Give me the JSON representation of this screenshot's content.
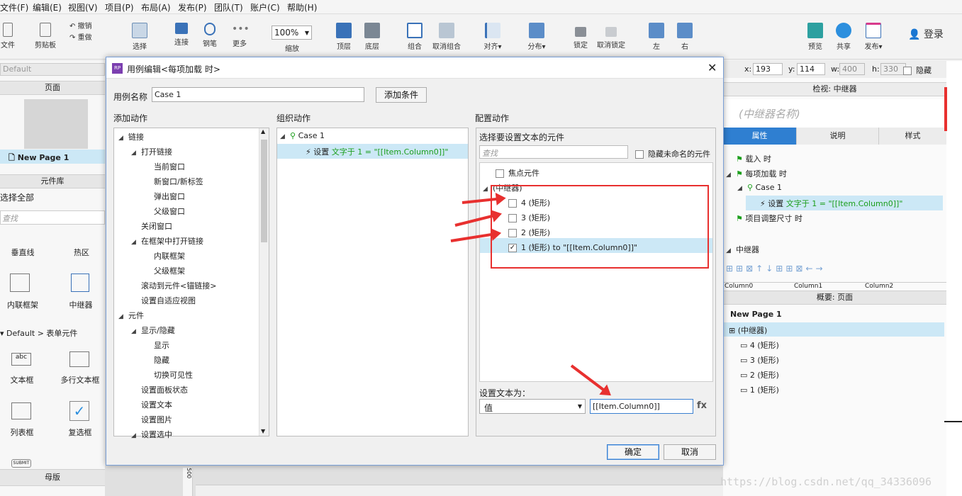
{
  "menu": [
    "文件(F)",
    "编辑(E)",
    "视图(V)",
    "项目(P)",
    "布局(A)",
    "发布(P)",
    "团队(T)",
    "账户(C)",
    "帮助(H)"
  ],
  "toolbar": {
    "file": "文件",
    "clipboard": "剪贴板",
    "undo": "撤销",
    "redo": "重做",
    "select": "选择",
    "connect": "连接",
    "pen": "钢笔",
    "more": "更多",
    "zoom_value": "100%",
    "zoom_label": "缩放",
    "top": "顶层",
    "bottom": "底层",
    "group": "组合",
    "ungroup": "取消组合",
    "align": "对齐",
    "distribute": "分布",
    "lock": "锁定",
    "unlock": "取消锁定",
    "left": "左",
    "right": "右",
    "preview": "预览",
    "share": "共享",
    "publish": "发布",
    "login": "登录"
  },
  "left_panel": {
    "style_select": "Default",
    "pages_header": "页面",
    "page_item": "New Page 1",
    "widgets_header": "元件库",
    "select_all": "选择全部",
    "search_placeholder": "查找",
    "widgets": [
      {
        "label": "垂直线"
      },
      {
        "label": "热区"
      },
      {
        "label": "内联框架"
      },
      {
        "label": "中继器"
      }
    ],
    "section": "Default > 表单元件",
    "form_widgets": [
      {
        "label": "文本框"
      },
      {
        "label": "多行文本框"
      },
      {
        "label": "列表框"
      },
      {
        "label": "复选框"
      }
    ],
    "submit": "SUBMIT",
    "masters_header": "母版"
  },
  "prop_bar": {
    "x_label": "x:",
    "x": "193",
    "y_label": "y:",
    "y": "114",
    "w_label": "w:",
    "w": "400",
    "h_label": "h:",
    "h": "330",
    "hide": "隐藏"
  },
  "right_panel": {
    "inspect_header": "检视: 中继器",
    "name_placeholder": "(中继器名称)",
    "tabs": [
      "属性",
      "说明",
      "样式"
    ],
    "events": [
      "载入 时",
      "每项加载 时",
      "Case 1",
      "设置",
      "文字于 1 = \"[[Item.Column0]]\"",
      "项目调整尺寸 时"
    ],
    "repeater_section": "中继器",
    "columns": [
      "Column0",
      "Column1",
      "Column2"
    ],
    "outline_header": "概要: 页面",
    "outline": [
      "New Page 1",
      "(中继器)",
      "4 (矩形)",
      "3 (矩形)",
      "2 (矩形)",
      "1 (矩形)"
    ]
  },
  "dialog": {
    "icon": "RP",
    "title": "用例编辑<每项加载 时>",
    "case_name_label": "用例名称",
    "case_name": "Case 1",
    "add_condition": "添加条件",
    "add_action_header": "添加动作",
    "organize_header": "组织动作",
    "configure_header": "配置动作",
    "actions": [
      {
        "text": "链接",
        "level": 0,
        "tri": "◢"
      },
      {
        "text": "打开链接",
        "level": 1,
        "tri": "◢"
      },
      {
        "text": "当前窗口",
        "level": 2
      },
      {
        "text": "新窗口/新标签",
        "level": 2
      },
      {
        "text": "弹出窗口",
        "level": 2
      },
      {
        "text": "父级窗口",
        "level": 2
      },
      {
        "text": "关闭窗口",
        "level": 1
      },
      {
        "text": "在框架中打开链接",
        "level": 1,
        "tri": "◢"
      },
      {
        "text": "内联框架",
        "level": 2
      },
      {
        "text": "父级框架",
        "level": 2
      },
      {
        "text": "滚动到元件<锚链接>",
        "level": 1
      },
      {
        "text": "设置自适应视图",
        "level": 1
      },
      {
        "text": "元件",
        "level": 0,
        "tri": "◢"
      },
      {
        "text": "显示/隐藏",
        "level": 1,
        "tri": "◢"
      },
      {
        "text": "显示",
        "level": 2
      },
      {
        "text": "隐藏",
        "level": 2
      },
      {
        "text": "切换可见性",
        "level": 2
      },
      {
        "text": "设置面板状态",
        "level": 1
      },
      {
        "text": "设置文本",
        "level": 1
      },
      {
        "text": "设置图片",
        "level": 1
      },
      {
        "text": "设置选中",
        "level": 1,
        "tri": "◢"
      }
    ],
    "organize": {
      "case": "Case 1",
      "action_prefix": "设置",
      "action_detail": "文字于 1 = \"[[Item.Column0]]\""
    },
    "configure": {
      "select_label": "选择要设置文本的元件",
      "search_placeholder": "查找",
      "hide_unnamed": "隐藏未命名的元件",
      "focus_widget": "焦点元件",
      "repeater": "(中继器)",
      "items": [
        {
          "label": "4 (矩形)",
          "checked": false
        },
        {
          "label": "3 (矩形)",
          "checked": false
        },
        {
          "label": "2 (矩形)",
          "checked": false
        },
        {
          "label": "1 (矩形) to \"[[Item.Column0]]\"",
          "checked": true
        }
      ],
      "set_text_label": "设置文本为：",
      "type_value": "值",
      "value": "[[Item.Column0]]",
      "fx": "fx"
    },
    "ok": "确定",
    "cancel": "取消"
  },
  "canvas": {
    "ruler_value": "500"
  },
  "watermark": "https://blog.csdn.net/qq_34336096",
  "colors": {
    "selected": "#cce8f6",
    "accent_blue": "#2f7fd1",
    "annotation_red": "#e8302f",
    "action_green": "#1b9e1b"
  }
}
